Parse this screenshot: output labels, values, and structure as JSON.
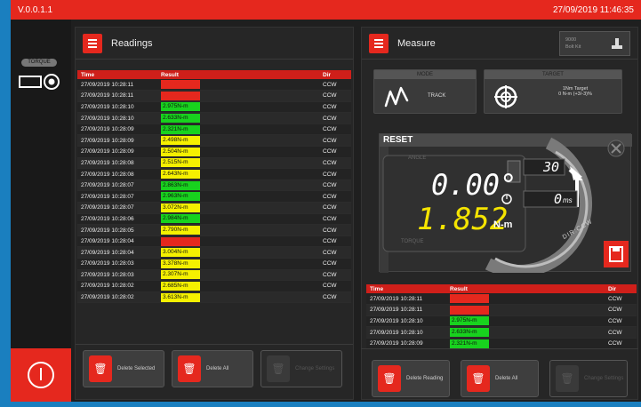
{
  "topbar": {
    "version": "V.0.0.1.1",
    "datetime": "27/09/2019 11:46:35"
  },
  "rail": {
    "chip_label": "TORQUE"
  },
  "readings": {
    "title": "Readings",
    "headers": {
      "time": "Time",
      "result": "Result",
      "dir": "Dir"
    },
    "rows": [
      {
        "time": "27/09/2019 10:28:11",
        "result": "2.245N-m",
        "dir": "CCW",
        "status": "red"
      },
      {
        "time": "27/09/2019 10:28:11",
        "result": "2.237N-m",
        "dir": "CCW",
        "status": "red"
      },
      {
        "time": "27/09/2019 10:28:10",
        "result": "2.975N-m",
        "dir": "CCW",
        "status": "green"
      },
      {
        "time": "27/09/2019 10:28:10",
        "result": "2.633N-m",
        "dir": "CCW",
        "status": "green"
      },
      {
        "time": "27/09/2019 10:28:09",
        "result": "2.321N-m",
        "dir": "CCW",
        "status": "green"
      },
      {
        "time": "27/09/2019 10:28:09",
        "result": "2.498N-m",
        "dir": "CCW",
        "status": "yellow"
      },
      {
        "time": "27/09/2019 10:28:09",
        "result": "2.504N-m",
        "dir": "CCW",
        "status": "yellow"
      },
      {
        "time": "27/09/2019 10:28:08",
        "result": "2.515N-m",
        "dir": "CCW",
        "status": "yellow"
      },
      {
        "time": "27/09/2019 10:28:08",
        "result": "2.643N-m",
        "dir": "CCW",
        "status": "yellow"
      },
      {
        "time": "27/09/2019 10:28:07",
        "result": "2.863N-m",
        "dir": "CCW",
        "status": "green"
      },
      {
        "time": "27/09/2019 10:28:07",
        "result": "2.963N-m",
        "dir": "CCW",
        "status": "green"
      },
      {
        "time": "27/09/2019 10:28:07",
        "result": "3.072N-m",
        "dir": "CCW",
        "status": "yellow"
      },
      {
        "time": "27/09/2019 10:28:06",
        "result": "2.984N-m",
        "dir": "CCW",
        "status": "green"
      },
      {
        "time": "27/09/2019 10:28:05",
        "result": "2.790N-m",
        "dir": "CCW",
        "status": "yellow"
      },
      {
        "time": "27/09/2019 10:28:04",
        "result": "2.110N-m",
        "dir": "CCW",
        "status": "red"
      },
      {
        "time": "27/09/2019 10:28:04",
        "result": "3.004N-m",
        "dir": "CCW",
        "status": "yellow"
      },
      {
        "time": "27/09/2019 10:28:03",
        "result": "3.378N-m",
        "dir": "CCW",
        "status": "yellow"
      },
      {
        "time": "27/09/2019 10:28:03",
        "result": "2.307N-m",
        "dir": "CCW",
        "status": "yellow"
      },
      {
        "time": "27/09/2019 10:28:02",
        "result": "2.685N-m",
        "dir": "CCW",
        "status": "yellow"
      },
      {
        "time": "27/09/2019 10:28:02",
        "result": "3.613N-m",
        "dir": "CCW",
        "status": "yellow"
      }
    ],
    "buttons": {
      "delete_selected": "Delete Selected",
      "delete_all": "Delete All",
      "disabled": "Change Settings"
    }
  },
  "measure": {
    "title": "Measure",
    "corner": {
      "line1": "9000",
      "line2": "Bolt Kit"
    },
    "mode": {
      "caption": "MODE",
      "value": "TRACK"
    },
    "target": {
      "caption": "TARGET",
      "line1": "1Nm Target",
      "line2": "0 N-m (+3/-3)%"
    },
    "reset_label": "RESET",
    "angle_label": "ANGLE",
    "angle_value": "0.00°",
    "torque_value": "1.852",
    "unit": "N-m",
    "torque_label": "TORQUE",
    "counter": "30",
    "timer": "0",
    "timer_unit": "ms",
    "direction": "DIR:CCW",
    "table_headers": {
      "time": "Time",
      "result": "Result",
      "dir": "Dir"
    },
    "rows": [
      {
        "time": "27/09/2019 10:28:11",
        "result": "2.245N-m",
        "dir": "CCW",
        "status": "red"
      },
      {
        "time": "27/09/2019 10:28:11",
        "result": "2.237N-m",
        "dir": "CCW",
        "status": "red"
      },
      {
        "time": "27/09/2019 10:28:10",
        "result": "2.975N-m",
        "dir": "CCW",
        "status": "green"
      },
      {
        "time": "27/09/2019 10:28:10",
        "result": "2.633N-m",
        "dir": "CCW",
        "status": "green"
      },
      {
        "time": "27/09/2019 10:28:09",
        "result": "2.321N-m",
        "dir": "CCW",
        "status": "green"
      }
    ],
    "buttons": {
      "delete_reading": "Delete Reading",
      "delete_all": "Delete All",
      "disabled": "Change Settings"
    }
  },
  "colors": {
    "accent": "#e5281e",
    "good": "#18d21e",
    "warn": "#f5f000",
    "frame": "#1a7fbf"
  }
}
